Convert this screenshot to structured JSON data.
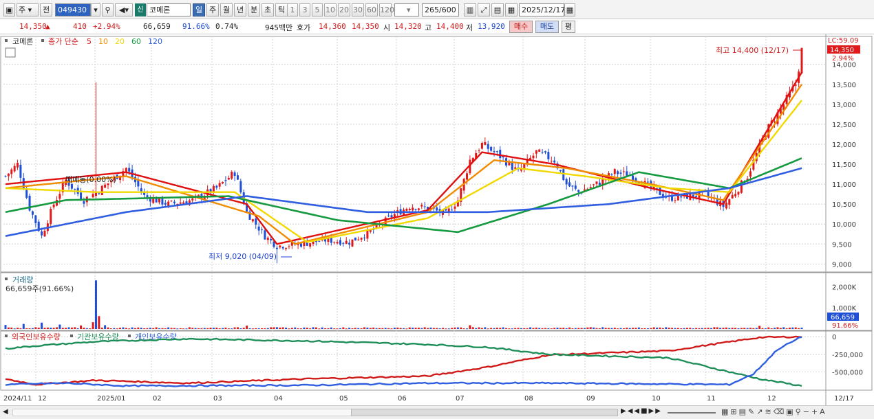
{
  "toolbar": {
    "market_label": "주",
    "prev_label": "전",
    "stock_code": "049430",
    "new_label": "신",
    "stock_name": "코메론",
    "periods": [
      "일",
      "주",
      "월",
      "년",
      "분",
      "초",
      "틱"
    ],
    "active_period": "일",
    "intervals": [
      "1",
      "3",
      "5",
      "10",
      "20",
      "30",
      "60",
      "120"
    ],
    "count_value": "265",
    "count_max": "/600",
    "date_value": "2025/12/17"
  },
  "quote": {
    "price": "14,350",
    "change_arrow": "▲",
    "change": "410",
    "change_pct": "+2.94%",
    "volume": "66,659",
    "volume_ratio": "91.66%",
    "turnover_pct": "0.74%",
    "amount": "945백만",
    "hoga_label": "호가",
    "ask": "14,360",
    "bid": "14,350",
    "open_label": "시",
    "open": "14,320",
    "high_label": "고",
    "high": "14,400",
    "low_label": "저",
    "low": "13,920",
    "buy_label": "매수",
    "sell_label": "매도",
    "eval_label": "평"
  },
  "legend": {
    "stock": "코메론",
    "ma_prefix": "종가 단순",
    "ma_periods": [
      "5",
      "10",
      "20",
      "60",
      "120"
    ],
    "ma_colors": [
      "#e01010",
      "#f08c00",
      "#f0d800",
      "#159a40",
      "#2f5fe0"
    ]
  },
  "price_panel": {
    "lc_label": "LC:59.09",
    "current_tag": "14,350",
    "current_pct": "2.94%",
    "high_annotation": "최고 14,400 (12/17)",
    "low_annotation": "최저 9,020 (04/09)",
    "mid_annotation": "매매동(0.00%)"
  },
  "volume_panel": {
    "title": "거래량",
    "subtitle": "66,659주(91.66%)",
    "current_tag": "66,659",
    "current_pct": "91.66%"
  },
  "holdings_panel": {
    "series": [
      {
        "name": "외국인보유수량",
        "color": "#d11a1a"
      },
      {
        "name": "기관보유수량",
        "color": "#1f8f5a"
      },
      {
        "name": "개인보유수량",
        "color": "#2f5fe0"
      }
    ]
  },
  "chart_data": [
    {
      "type": "candlestick",
      "title": "코메론",
      "y_ticks": [
        "14,000",
        "13,500",
        "13,000",
        "12,500",
        "12,000",
        "11,500",
        "11,000",
        "10,500",
        "10,000",
        "9,500",
        "9,000"
      ],
      "ylim": [
        8800,
        14700
      ],
      "x_labels": [
        "2024/11",
        "12",
        "2025/01",
        "02",
        "03",
        "04",
        "05",
        "06",
        "07",
        "08",
        "09",
        "10",
        "11",
        "12",
        "12/17"
      ],
      "close_anchors": [
        [
          0,
          11200
        ],
        [
          4,
          11500
        ],
        [
          8,
          10400
        ],
        [
          12,
          9700
        ],
        [
          16,
          10500
        ],
        [
          20,
          11100
        ],
        [
          26,
          10600
        ],
        [
          32,
          10900
        ],
        [
          40,
          11400
        ],
        [
          46,
          10700
        ],
        [
          54,
          10500
        ],
        [
          62,
          10600
        ],
        [
          70,
          10900
        ],
        [
          76,
          11300
        ],
        [
          80,
          10300
        ],
        [
          86,
          9700
        ],
        [
          90,
          9450
        ],
        [
          98,
          9500
        ],
        [
          106,
          9600
        ],
        [
          114,
          9550
        ],
        [
          122,
          9850
        ],
        [
          128,
          10200
        ],
        [
          134,
          10450
        ],
        [
          140,
          10400
        ],
        [
          146,
          10250
        ],
        [
          150,
          10600
        ],
        [
          154,
          11600
        ],
        [
          158,
          12000
        ],
        [
          164,
          11700
        ],
        [
          170,
          11300
        ],
        [
          176,
          11800
        ],
        [
          182,
          11600
        ],
        [
          186,
          11000
        ],
        [
          190,
          10800
        ],
        [
          196,
          11000
        ],
        [
          202,
          11300
        ],
        [
          208,
          11200
        ],
        [
          214,
          10900
        ],
        [
          220,
          10650
        ],
        [
          226,
          10700
        ],
        [
          232,
          10750
        ],
        [
          238,
          10450
        ],
        [
          242,
          10800
        ],
        [
          246,
          11200
        ],
        [
          252,
          12300
        ],
        [
          258,
          13000
        ],
        [
          262,
          13500
        ],
        [
          264,
          14350
        ]
      ],
      "ma_series": [
        {
          "name": "5",
          "values": [
            [
              0,
              11000
            ],
            [
              40,
              11300
            ],
            [
              80,
              10500
            ],
            [
              90,
              9500
            ],
            [
              140,
              10350
            ],
            [
              158,
              11800
            ],
            [
              182,
              11500
            ],
            [
              214,
              10900
            ],
            [
              238,
              10500
            ],
            [
              264,
              13800
            ]
          ]
        },
        {
          "name": "10",
          "values": [
            [
              0,
              10900
            ],
            [
              40,
              11200
            ],
            [
              84,
              10200
            ],
            [
              96,
              9500
            ],
            [
              140,
              10300
            ],
            [
              162,
              11600
            ],
            [
              186,
              11400
            ],
            [
              214,
              11000
            ],
            [
              238,
              10600
            ],
            [
              264,
              13500
            ]
          ]
        },
        {
          "name": "20",
          "values": [
            [
              0,
              10900
            ],
            [
              30,
              10800
            ],
            [
              76,
              10800
            ],
            [
              100,
              9550
            ],
            [
              140,
              10150
            ],
            [
              170,
              11400
            ],
            [
              192,
              11200
            ],
            [
              220,
              10900
            ],
            [
              240,
              10800
            ],
            [
              264,
              13100
            ]
          ]
        },
        {
          "name": "60",
          "values": [
            [
              0,
              10300
            ],
            [
              20,
              10600
            ],
            [
              74,
              10700
            ],
            [
              110,
              10100
            ],
            [
              150,
              9800
            ],
            [
              180,
              10500
            ],
            [
              210,
              11300
            ],
            [
              240,
              10900
            ],
            [
              264,
              11650
            ]
          ]
        },
        {
          "name": "120",
          "values": [
            [
              0,
              9700
            ],
            [
              40,
              10300
            ],
            [
              80,
              10700
            ],
            [
              120,
              10300
            ],
            [
              160,
              10300
            ],
            [
              200,
              10500
            ],
            [
              240,
              10900
            ],
            [
              264,
              11400
            ]
          ]
        }
      ],
      "high_point": {
        "label": "최고 14,400 (12/17)",
        "value": 14400,
        "index": 264
      },
      "low_point": {
        "label": "최저 9,020 (04/09)",
        "value": 9020,
        "index": 90
      }
    },
    {
      "type": "bar",
      "title": "거래량",
      "y_ticks": [
        "2,000K",
        "1,000K"
      ],
      "ylim": [
        0,
        2600000
      ],
      "spikes": [
        [
          0,
          190000
        ],
        [
          6,
          240000
        ],
        [
          12,
          300000
        ],
        [
          18,
          210000
        ],
        [
          25,
          170000
        ],
        [
          29,
          320000
        ],
        [
          30,
          2300000
        ],
        [
          31,
          610000
        ],
        [
          33,
          180000
        ],
        [
          80,
          160000
        ],
        [
          154,
          180000
        ],
        [
          250,
          150000
        ],
        [
          264,
          66659
        ]
      ]
    },
    {
      "type": "line",
      "title": "외국인보유수량 / 기관보유수량 / 개인보유수량",
      "y_ticks": [
        "0",
        "-250,000",
        "-500,000"
      ],
      "ylim": [
        -760000,
        80000
      ],
      "series": [
        {
          "name": "외국인보유수량",
          "values": [
            [
              0,
              -600000
            ],
            [
              10,
              -680000
            ],
            [
              30,
              -620000
            ],
            [
              60,
              -660000
            ],
            [
              100,
              -600000
            ],
            [
              140,
              -560000
            ],
            [
              160,
              -430000
            ],
            [
              180,
              -260000
            ],
            [
              220,
              -200000
            ],
            [
              250,
              -10000
            ],
            [
              264,
              0
            ]
          ]
        },
        {
          "name": "기관보유수량",
          "values": [
            [
              0,
              -170000
            ],
            [
              10,
              -130000
            ],
            [
              30,
              -70000
            ],
            [
              60,
              -30000
            ],
            [
              100,
              -60000
            ],
            [
              140,
              -110000
            ],
            [
              160,
              -150000
            ],
            [
              180,
              -250000
            ],
            [
              220,
              -300000
            ],
            [
              250,
              -600000
            ],
            [
              264,
              -700000
            ]
          ]
        },
        {
          "name": "개인보유수량",
          "values": [
            [
              0,
              -680000
            ],
            [
              20,
              -660000
            ],
            [
              40,
              -700000
            ],
            [
              100,
              -690000
            ],
            [
              140,
              -660000
            ],
            [
              180,
              -660000
            ],
            [
              240,
              -680000
            ],
            [
              248,
              -530000
            ],
            [
              256,
              -180000
            ],
            [
              264,
              0
            ]
          ]
        }
      ]
    }
  ]
}
